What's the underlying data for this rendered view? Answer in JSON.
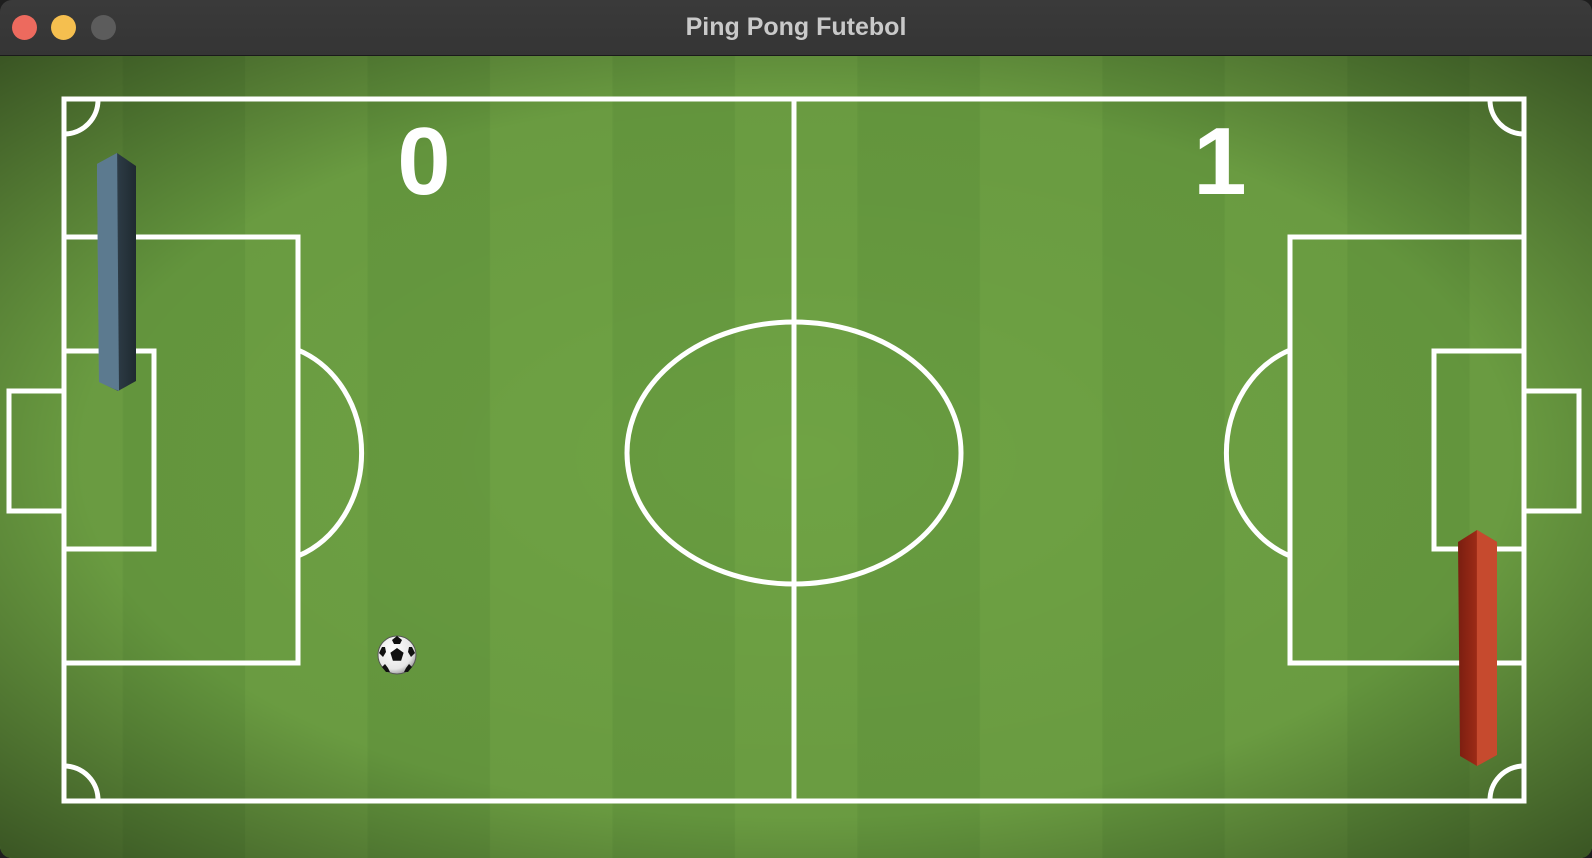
{
  "window": {
    "title": "Ping Pong Futebol"
  },
  "game": {
    "score_left": "0",
    "score_right": "1",
    "colors": {
      "pitch_light": "#73a847",
      "pitch_dark": "#4e7a2d",
      "lines": "#ffffff",
      "paddle_left": "#4f6b80",
      "paddle_right": "#b23a22"
    }
  }
}
